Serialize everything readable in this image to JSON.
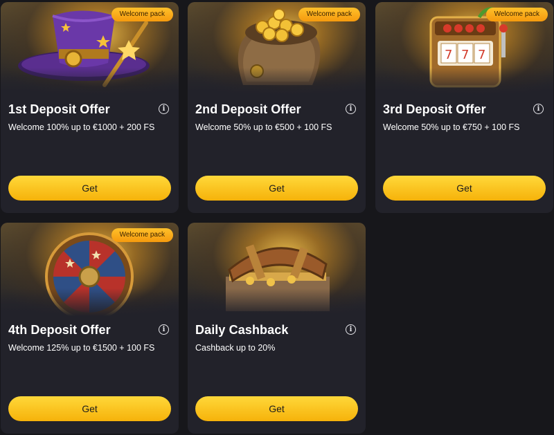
{
  "cards": [
    {
      "badge": "Welcome pack",
      "title": "1st Deposit Offer",
      "desc": "Welcome 100% up to €1000 + 200 FS",
      "button": "Get"
    },
    {
      "badge": "Welcome pack",
      "title": "2nd Deposit Offer",
      "desc": "Welcome 50% up to €500 + 100 FS",
      "button": "Get"
    },
    {
      "badge": "Welcome pack",
      "title": "3rd Deposit Offer",
      "desc": "Welcome 50% up to €750 + 100 FS",
      "button": "Get"
    },
    {
      "badge": "Welcome pack",
      "title": "4th Deposit Offer",
      "desc": "Welcome 125% up to €1500 + 100 FS",
      "button": "Get"
    },
    {
      "title": "Daily Cashback",
      "desc": "Cashback up to 20%",
      "button": "Get"
    }
  ],
  "colors": {
    "background": "#17171b",
    "card": "#22222a",
    "button": "#f6b20a",
    "badge": "#f59a0e"
  }
}
